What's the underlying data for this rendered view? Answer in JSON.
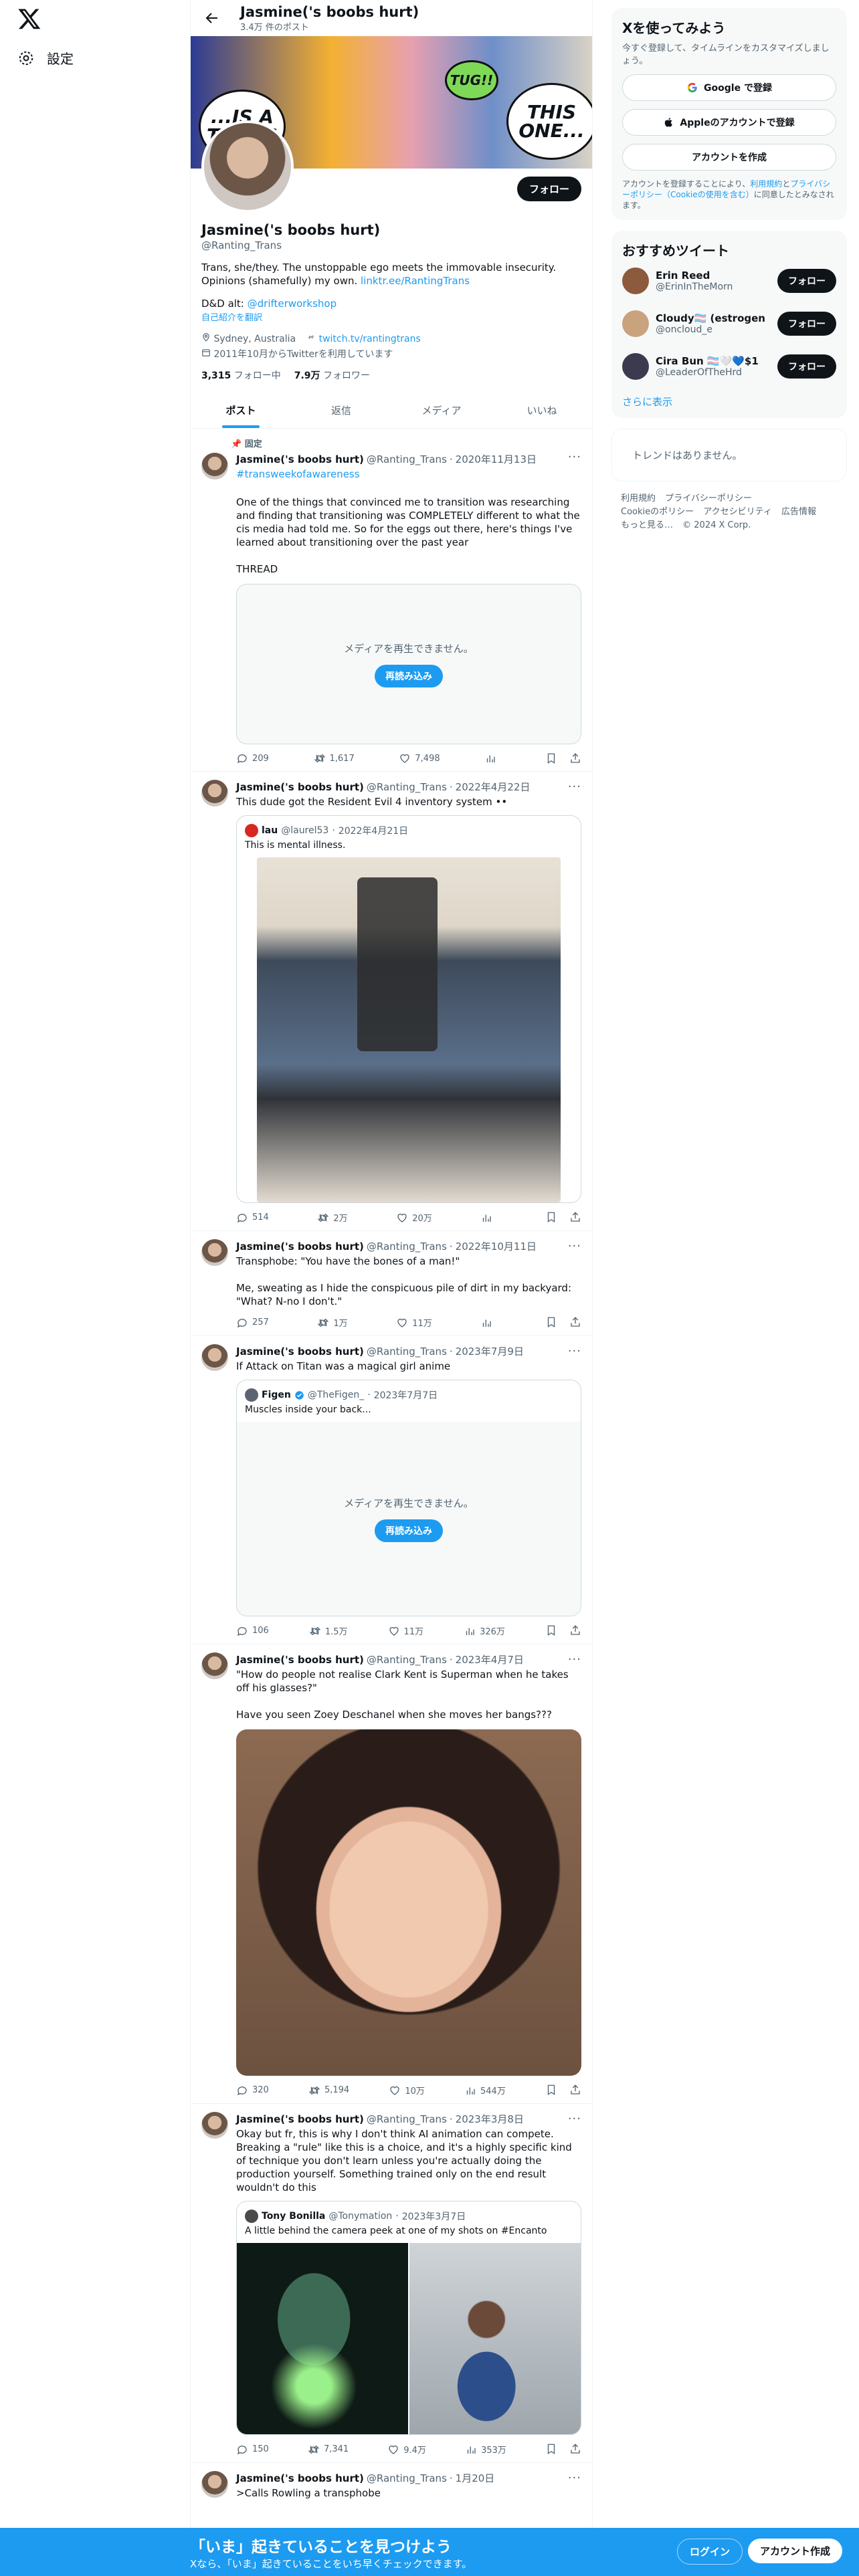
{
  "nav": {
    "settings_label": "設定"
  },
  "header": {
    "name": "Jasmine('s boobs hurt)",
    "post_count": "3.4万 件のポスト"
  },
  "profile": {
    "follow_label": "フォロー",
    "name": "Jasmine('s boobs hurt)",
    "handle": "@Ranting_Trans",
    "bio": "Trans, she/they. The unstoppable ego meets the immovable insecurity. Opinions (shamefully) my own.",
    "bio_link": "linktr.ee/RantingTrans",
    "dnd_alt_prefix": "D&D alt:",
    "dnd_alt_link": "@drifterworkshop",
    "translate": "自己紹介を翻訳",
    "location": "Sydney, Australia",
    "website": "twitch.tv/rantingtrans",
    "joined": "2011年10月からTwitterを利用しています",
    "following_count": "3,315",
    "following_label": "フォロー中",
    "followers_count": "7.9万",
    "followers_label": "フォロワー",
    "banner_bubble_1": "...IS A TRANS",
    "banner_bubble_2": "THIS ONE...",
    "banner_bubble_3": "TUG!!"
  },
  "tabs": [
    "ポスト",
    "返信",
    "メディア",
    "いいね"
  ],
  "tweets": [
    {
      "pinned_label": "固定",
      "name": "Jasmine('s boobs hurt)",
      "handle": "@Ranting_Trans",
      "date": "2020年11月13日",
      "hashtag": "#transweekofawareness",
      "text": "One of the things that convinced me to transition was researching and finding that transitioning was COMPLETELY different to what the cis media had told me. So for the eggs out there, here's things I've learned about transitioning over the past year\n\nTHREAD",
      "media_error": "メディアを再生できません。",
      "reload": "再読み込み",
      "replies": "209",
      "retweets": "1,617",
      "likes": "7,498",
      "views": ""
    },
    {
      "name": "Jasmine('s boobs hurt)",
      "handle": "@Ranting_Trans",
      "date": "2022年4月22日",
      "text": "This dude got the Resident Evil 4 inventory system ••",
      "quote": {
        "name": "lau",
        "handle": "@laurel53",
        "date": "2022年4月21日",
        "text": "This is mental illness."
      },
      "replies": "514",
      "retweets": "2万",
      "likes": "20万",
      "views": ""
    },
    {
      "name": "Jasmine('s boobs hurt)",
      "handle": "@Ranting_Trans",
      "date": "2022年10月11日",
      "text": "Transphobe: \"You have the bones of a man!\"\n\nMe, sweating as I hide the conspicuous pile of dirt in my backyard: \"What? N-no I don't.\"",
      "replies": "257",
      "retweets": "1万",
      "likes": "11万",
      "views": ""
    },
    {
      "name": "Jasmine('s boobs hurt)",
      "handle": "@Ranting_Trans",
      "date": "2023年7月9日",
      "text": "If Attack on Titan was a magical girl anime",
      "quote": {
        "name": "Figen",
        "handle": "@TheFigen_",
        "date": "2023年7月7日",
        "text": "Muscles inside your back..."
      },
      "media_error": "メディアを再生できません。",
      "reload": "再読み込み",
      "replies": "106",
      "retweets": "1.5万",
      "likes": "11万",
      "views": "326万"
    },
    {
      "name": "Jasmine('s boobs hurt)",
      "handle": "@Ranting_Trans",
      "date": "2023年4月7日",
      "text": "\"How do people not realise Clark Kent is Superman when he takes off his glasses?\"\n\nHave you seen Zoey Deschanel when she moves her bangs???",
      "replies": "320",
      "retweets": "5,194",
      "likes": "10万",
      "views": "544万"
    },
    {
      "name": "Jasmine('s boobs hurt)",
      "handle": "@Ranting_Trans",
      "date": "2023年3月8日",
      "text": "Okay but fr, this is why I don't think AI animation can compete. Breaking a \"rule\" like this is a choice, and it's a highly specific kind of technique you don't learn unless you're actually doing the production yourself. Something trained only on the end result wouldn't do this",
      "quote": {
        "name": "Tony Bonilla",
        "handle": "@Tonymation",
        "date": "2023年3月7日",
        "text": "A little behind the camera peek at one of my shots on #Encanto"
      },
      "replies": "150",
      "retweets": "7,341",
      "likes": "9.4万",
      "views": "353万"
    },
    {
      "name": "Jasmine('s boobs hurt)",
      "handle": "@Ranting_Trans",
      "date": "1月20日",
      "text": ">Calls Rowling a transphobe"
    }
  ],
  "sidebar": {
    "signup": {
      "title": "Xを使ってみよう",
      "subtitle": "今すぐ登録して、タイムラインをカスタマイズしましょう。",
      "google": "Google で登録",
      "apple": "Appleのアカウントで登録",
      "create": "アカウントを作成",
      "legal_pre": "アカウントを登録することにより、",
      "legal_terms": "利用規約",
      "legal_and": "と",
      "legal_privacy": "プライバシーポリシー",
      "legal_cookie": "（Cookieの使用を含む）",
      "legal_post": "に同意したとみなされます。"
    },
    "who_to_follow": {
      "title": "おすすめツイート",
      "users": [
        {
          "name": "Erin Reed",
          "handle": "@ErinInTheMorn",
          "color": "#8c5a3c"
        },
        {
          "name": "Cloudy🏳️‍⚧️ (estrogen arc)",
          "handle": "@oncloud_e",
          "color": "#c9a27e"
        },
        {
          "name": "Cira Bun 🏳️‍⚧️🤍💙$1",
          "handle": "@LeaderOfTheHrd",
          "color": "#3b3a4e"
        }
      ],
      "follow_label": "フォロー",
      "show_more": "さらに表示"
    },
    "trends_empty": "トレンドはありません。",
    "footer_links": [
      "利用規約",
      "プライバシーポリシー",
      "Cookieのポリシー",
      "アクセシビリティ",
      "広告情報",
      "もっと見る…",
      "© 2024 X Corp."
    ]
  },
  "bottom_bar": {
    "title": "「いま」起きていることを見つけよう",
    "subtitle": "Xなら、「いま」起きていることをいち早くチェックできます。",
    "login": "ログイン",
    "signup": "アカウント作成"
  },
  "colors": {
    "accent": "#1d9bf0",
    "text": "#0f1419",
    "muted": "#536471"
  }
}
